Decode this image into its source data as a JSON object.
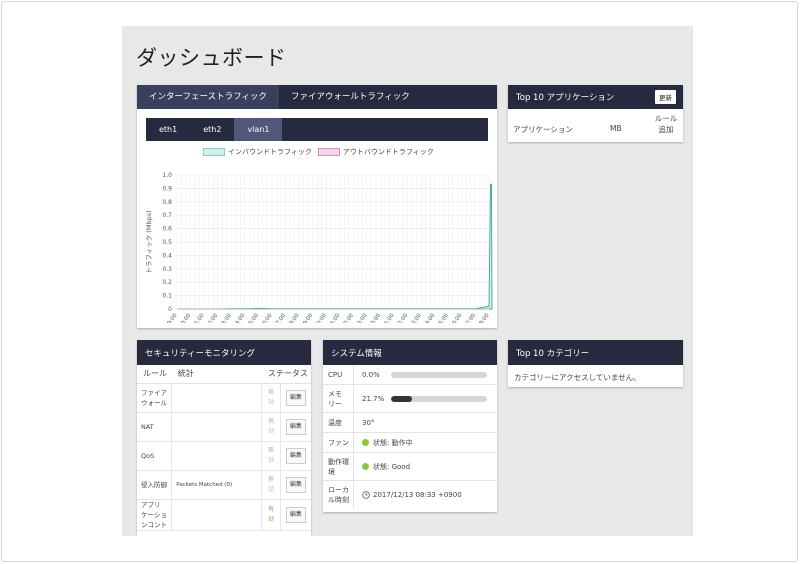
{
  "page": {
    "title": "ダッシュボード"
  },
  "traffic": {
    "tabs": [
      "インターフェーストラフィック",
      "ファイアウォールトラフィック"
    ],
    "subtabs": [
      "eth1",
      "eth2",
      "vlan1"
    ],
    "legend": {
      "inbound": "インバウンドトラフィック",
      "outbound": "アウトバウンドトラフィック"
    },
    "colors": {
      "inbound_fill": "#d6efed",
      "inbound_line": "#3aa69b",
      "outbound_fill": "#f3d5ea",
      "outbound_line": "#d98cc4"
    }
  },
  "chart_data": {
    "type": "area",
    "ylabel": "トラフィック (Mbps)",
    "xlabel": "",
    "ylim": [
      0,
      1
    ],
    "y_ticks": [
      "1.0",
      "0.9",
      "0.8",
      "0.7",
      "0.6",
      "0.5",
      "0.4",
      "0.3",
      "0.2",
      "0.1",
      "0"
    ],
    "x": [
      "09:00",
      "10:00",
      "11:00",
      "12:00",
      "13:00",
      "14:00",
      "15:00",
      "16:00",
      "17:00",
      "18:00",
      "19:00",
      "20:00",
      "21:00",
      "22:00",
      "23:00",
      "00:00",
      "01:00",
      "02:00",
      "03:00",
      "04:00",
      "05:00",
      "06:00",
      "07:00",
      "08:00"
    ],
    "grid": true,
    "legend": "top",
    "series": [
      {
        "name": "インバウンドトラフィック",
        "values": [
          0,
          0,
          0,
          0,
          0.002,
          0.002,
          0.005,
          0.002,
          0.002,
          0.002,
          0.002,
          0.002,
          0.002,
          0.002,
          0.002,
          0.002,
          0.002,
          0.002,
          0.002,
          0.002,
          0.002,
          0.002,
          0.002,
          0.02
        ],
        "spike": 0.93
      },
      {
        "name": "アウトバウンドトラフィック",
        "values": [
          0,
          0,
          0,
          0,
          0.001,
          0.001,
          0.002,
          0.001,
          0.001,
          0.001,
          0.001,
          0.001,
          0.001,
          0.001,
          0.001,
          0.001,
          0.001,
          0.001,
          0.001,
          0.001,
          0.001,
          0.001,
          0.001,
          0.005
        ]
      }
    ]
  },
  "apps": {
    "title": "Top 10 アプリケーション",
    "refresh": "更新",
    "col_app": "アプリケーション",
    "col_mb": "MB",
    "col_rule_1": "ルール",
    "col_rule_2": "追加"
  },
  "security": {
    "title": "セキュリティーモニタリング",
    "headers": {
      "rule": "ルール",
      "stats": "統計",
      "status": "ステータス"
    },
    "rows": [
      {
        "rule": "ファイア\nウォール",
        "stats": "",
        "status": "無\n効",
        "edit": "編集"
      },
      {
        "rule": "NAT",
        "stats": "",
        "status": "無\n効",
        "edit": "編集"
      },
      {
        "rule": "QoS",
        "stats": "",
        "status": "無\n効",
        "edit": "編集"
      },
      {
        "rule": "侵入防御",
        "stats": "Packets Matched (0)",
        "status": "無\n効",
        "edit": "編集"
      },
      {
        "rule": "アプリ\nケーショ\nンコント",
        "stats": "",
        "status": "有\n効",
        "edit": "編集"
      }
    ]
  },
  "system": {
    "title": "システム情報",
    "cpu_label": "CPU",
    "cpu_value": "0.0%",
    "cpu_fraction": 0.0,
    "mem_label": "メモ\nリー",
    "mem_value": "21.7%",
    "mem_fraction": 0.217,
    "temp_label": "温度",
    "temp_value": "30°",
    "fan_label": "ファン",
    "fan_value": "状態: 動作中",
    "op_label": "動作環\n境",
    "op_value": "状態: Good",
    "time_label": "ローカ\nル時刻",
    "time_value": "2017/12/13 08:33 +0900"
  },
  "categories": {
    "title": "Top 10 カテゴリー",
    "message": "カテゴリーにアクセスしていません。"
  }
}
